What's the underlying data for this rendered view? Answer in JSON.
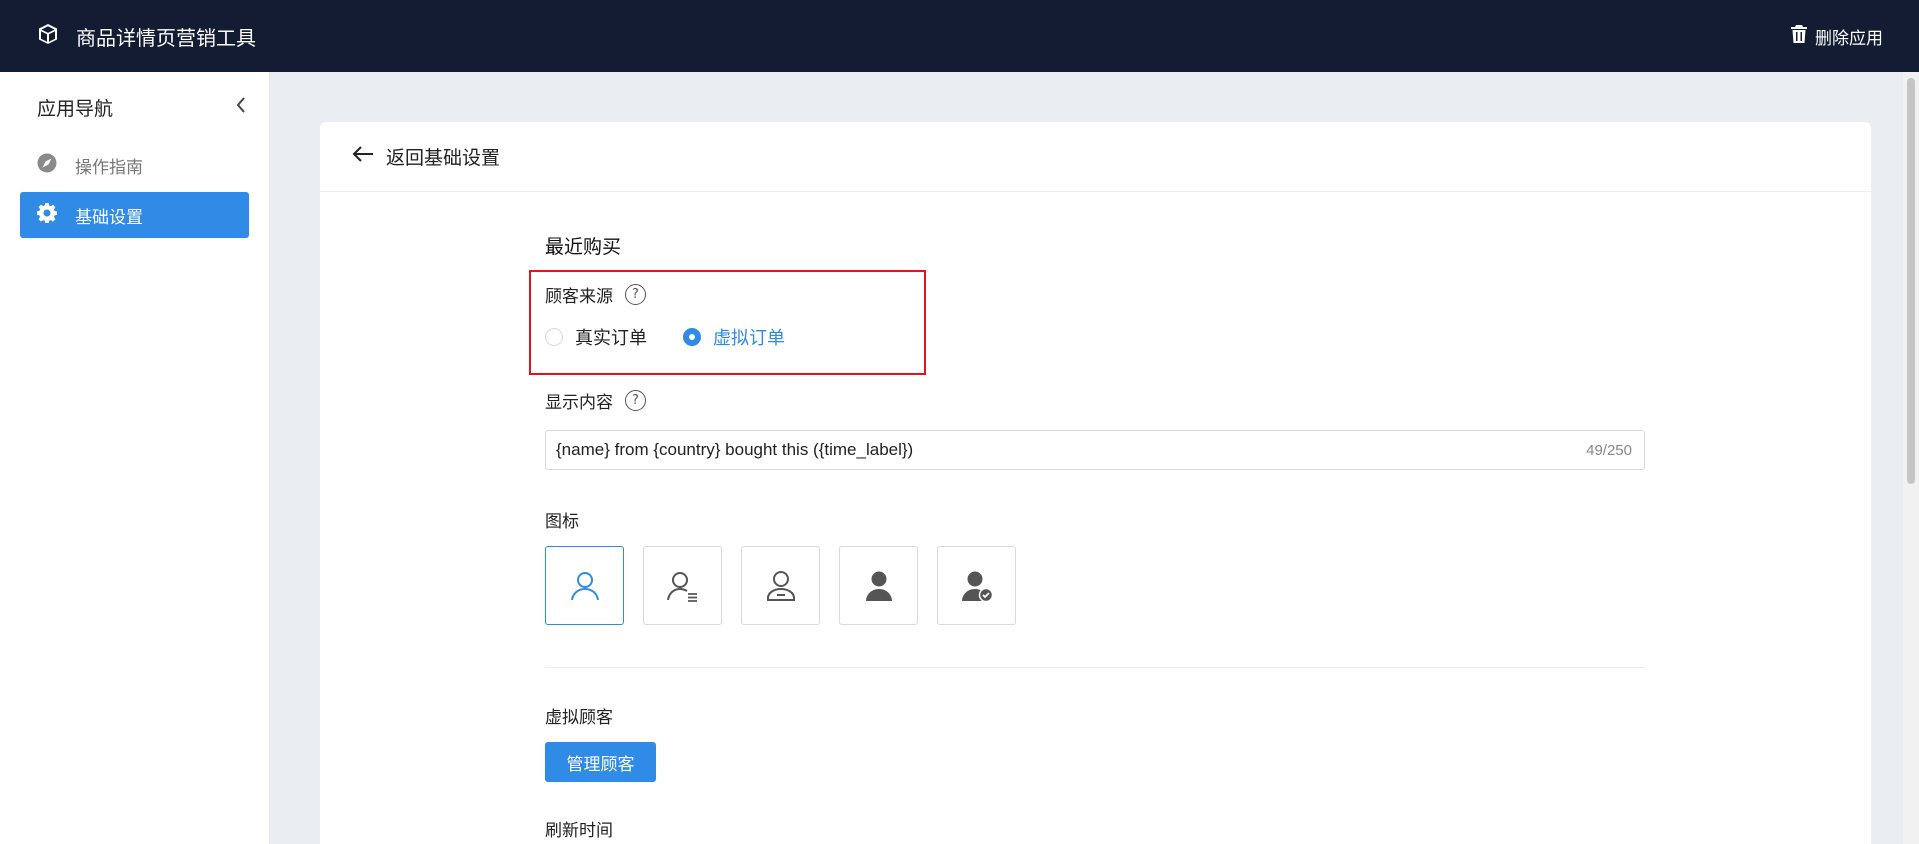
{
  "topbar": {
    "app_title": "商品详情页营销工具",
    "delete_label": "删除应用",
    "logo_icon": "cube-icon",
    "delete_icon": "trash-icon"
  },
  "sidebar": {
    "title": "应用导航",
    "items": [
      {
        "label": "操作指南",
        "icon": "compass-icon",
        "active": false
      },
      {
        "label": "基础设置",
        "icon": "gear-icon",
        "active": true
      }
    ]
  },
  "page": {
    "back_label": "返回基础设置",
    "section_title": "最近购买",
    "customer_source": {
      "label": "顾客来源",
      "options": [
        {
          "label": "真实订单",
          "checked": false
        },
        {
          "label": "虚拟订单",
          "checked": true
        }
      ]
    },
    "display_content": {
      "label": "显示内容",
      "value": "{name} from {country} bought this  ({time_label})",
      "counter": "49/250"
    },
    "icon_field": {
      "label": "图标",
      "options": [
        {
          "name": "user-outline-icon",
          "selected": true
        },
        {
          "name": "user-list-icon",
          "selected": false
        },
        {
          "name": "user-badge-icon",
          "selected": false
        },
        {
          "name": "user-solid-icon",
          "selected": false
        },
        {
          "name": "user-verified-icon",
          "selected": false
        }
      ]
    },
    "virtual_customers": {
      "label": "虚拟顾客",
      "button_label": "管理顾客"
    },
    "refresh_time": {
      "label": "刷新时间"
    }
  },
  "colors": {
    "topbar_bg": "#141c33",
    "accent": "#2f8be6",
    "highlight_border": "#e5141c"
  }
}
